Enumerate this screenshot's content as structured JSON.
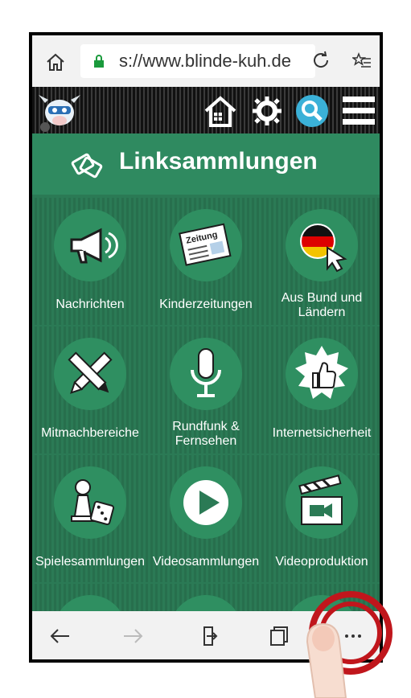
{
  "browser": {
    "url": "s://www.blinde-kuh.de"
  },
  "page": {
    "title": "Linksammlungen",
    "tiles": [
      {
        "label": "Nachrichten",
        "icon": "megaphone-icon"
      },
      {
        "label": "Kinderzeitungen",
        "icon": "newspaper-icon"
      },
      {
        "label": "Aus Bund und Ländern",
        "icon": "germany-flag-cursor-icon"
      },
      {
        "label": "Mitmachbereiche",
        "icon": "pencil-pen-icon"
      },
      {
        "label": "Rundfunk & Fernsehen",
        "icon": "microphone-icon"
      },
      {
        "label": "Internetsicherheit",
        "icon": "thumbs-up-icon"
      },
      {
        "label": "Spielesammlungen",
        "icon": "game-pawn-dice-icon"
      },
      {
        "label": "Videosammlungen",
        "icon": "play-icon"
      },
      {
        "label": "Videoproduktion",
        "icon": "clapperboard-icon"
      }
    ]
  },
  "colors": {
    "accent": "#2b7a55",
    "highlight_ring": "#c0161c"
  }
}
